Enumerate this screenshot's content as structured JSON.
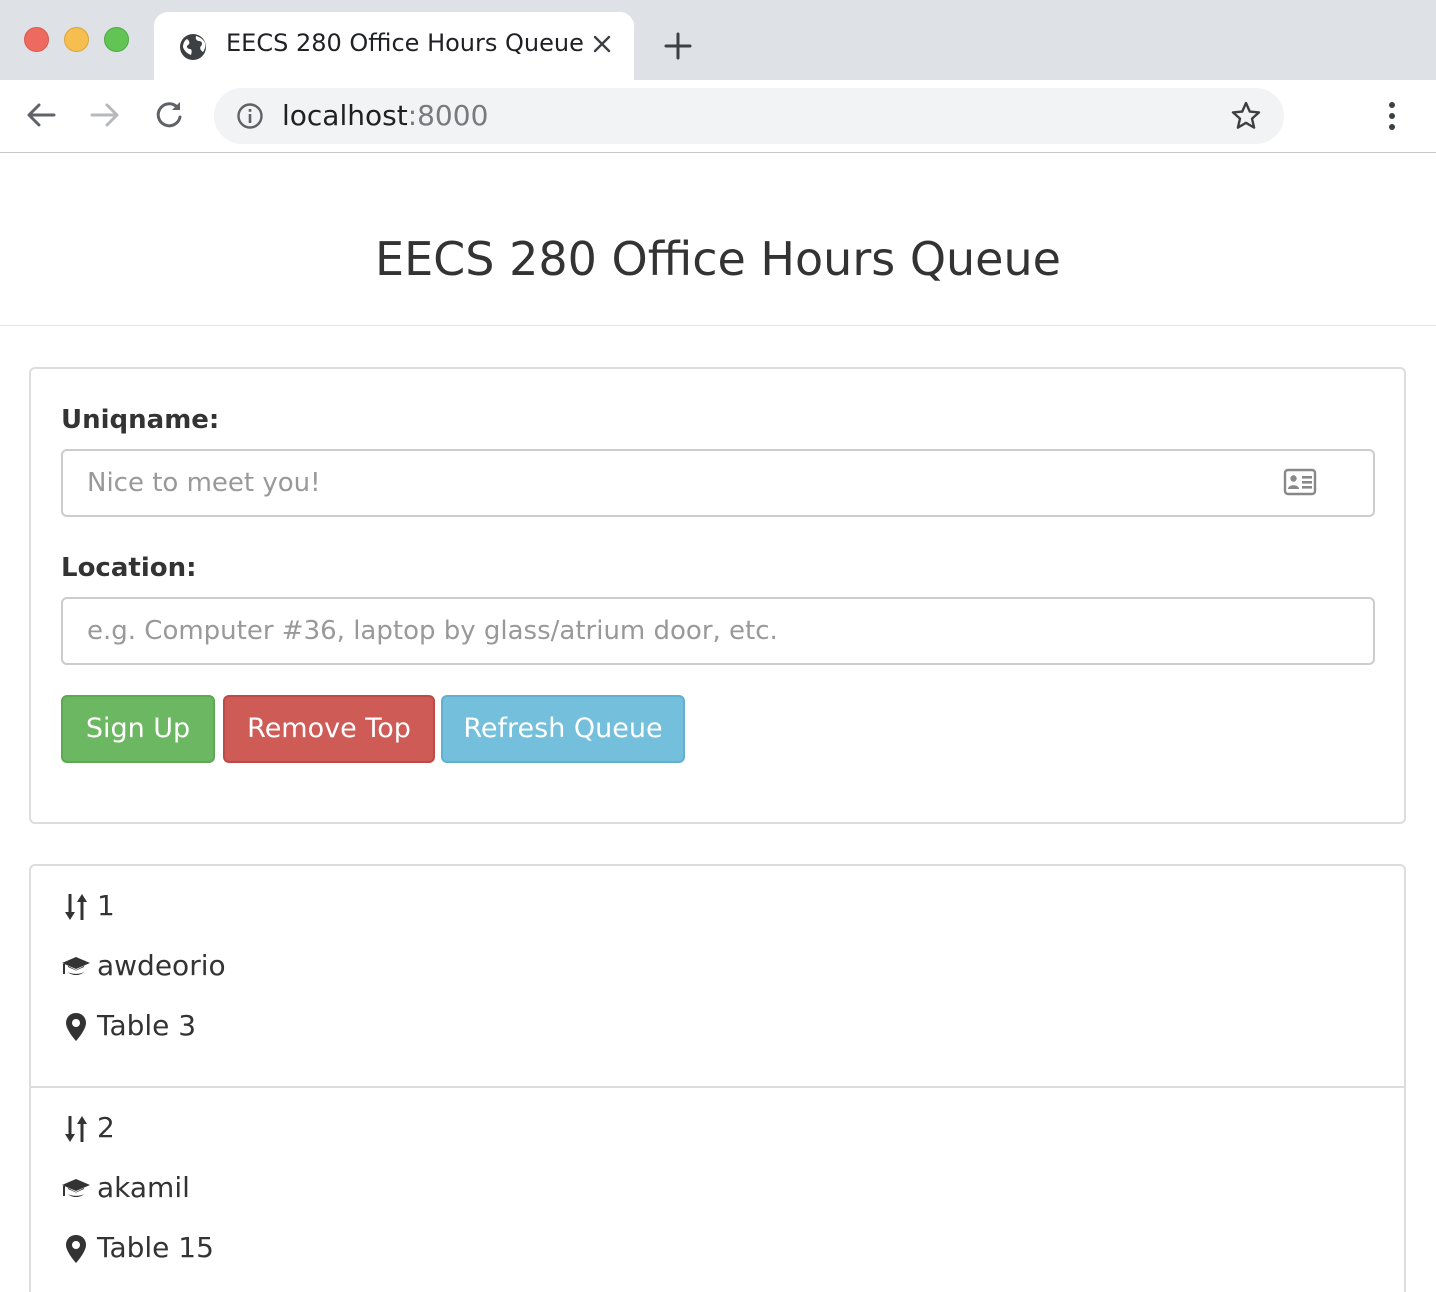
{
  "browser": {
    "tab_title": "EECS 280 Office Hours Queue",
    "url_host": "localhost",
    "url_port": ":8000",
    "icons": {
      "tab": "globe-icon",
      "close": "close-icon",
      "new_tab": "plus-icon",
      "back": "back-arrow-icon",
      "forward": "forward-arrow-icon",
      "reload": "reload-icon",
      "info": "info-icon",
      "bookmark": "star-icon",
      "menu": "kebab-menu-icon"
    }
  },
  "page": {
    "title": "EECS 280 Office Hours Queue"
  },
  "form": {
    "uniqname_label": "Uniqname:",
    "uniqname_placeholder": "Nice to meet you!",
    "uniqname_value": "",
    "location_label": "Location:",
    "location_placeholder": "e.g. Computer #36, laptop by glass/atrium door, etc.",
    "location_value": "",
    "signup_label": "Sign Up",
    "remove_label": "Remove Top",
    "refresh_label": "Refresh Queue",
    "colors": {
      "signup": "#6cb761",
      "remove": "#cf5b57",
      "refresh": "#73bfdc"
    }
  },
  "queue": [
    {
      "position": "1",
      "uniqname": "awdeorio",
      "location": "Table 3"
    },
    {
      "position": "2",
      "uniqname": "akamil",
      "location": "Table 15"
    }
  ]
}
